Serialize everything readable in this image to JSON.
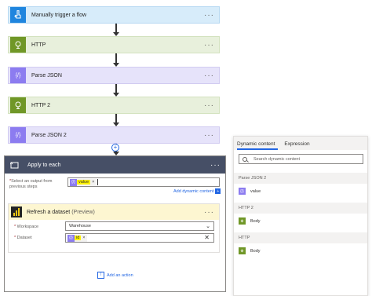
{
  "steps": [
    {
      "label": "Manually trigger a flow",
      "icon": "hand-touch-icon"
    },
    {
      "label": "HTTP",
      "icon": "globe-icon"
    },
    {
      "label": "Parse JSON",
      "icon": "json-braces-icon"
    },
    {
      "label": "HTTP 2",
      "icon": "globe-icon"
    },
    {
      "label": "Parse JSON 2",
      "icon": "json-braces-icon"
    }
  ],
  "more_glyph": "···",
  "apply_each": {
    "title": "Apply to each",
    "select_label": "Select an output from previous steps",
    "required_mark": "*",
    "token_value": "value",
    "token_x": "×",
    "add_dynamic": "Add dynamic content"
  },
  "refresh": {
    "title": "Refresh a dataset",
    "preview": "(Preview)",
    "workspace_label": "Workspace",
    "workspace_value": "Warehouse",
    "dataset_label": "Dataset",
    "dataset_token": "id",
    "token_x": "×",
    "clear": "✕"
  },
  "add_action": "Add an action",
  "panel": {
    "tab_dynamic": "Dynamic content",
    "tab_expression": "Expression",
    "search_placeholder": "Search dynamic content",
    "groups": [
      {
        "name": "Parse JSON 2",
        "item": "value",
        "kind": "json"
      },
      {
        "name": "HTTP 2",
        "item": "Body",
        "kind": "http"
      },
      {
        "name": "HTTP",
        "item": "Body",
        "kind": "http"
      }
    ]
  },
  "colors": {
    "trigger": "#1f85de",
    "http": "#709727",
    "json": "#8c7cf0",
    "apply_header": "#464f66",
    "accent": "#2266e3",
    "highlight": "#fff200"
  }
}
